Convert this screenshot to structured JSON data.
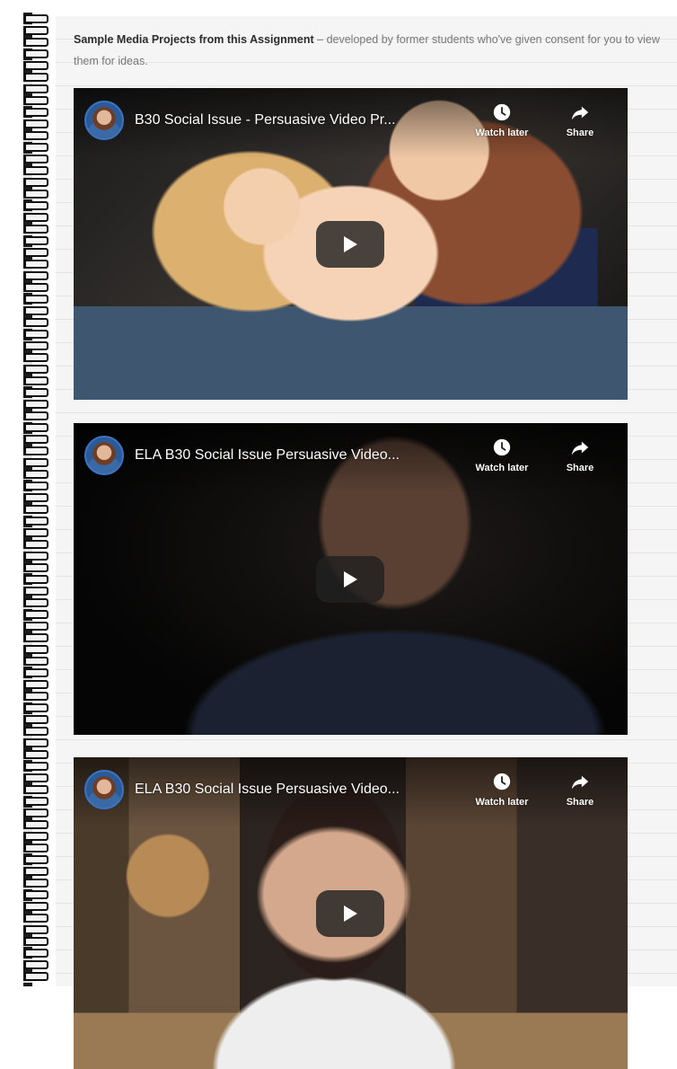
{
  "intro": {
    "bold": "Sample Media Projects from this Assignment",
    "rest": " – developed by former students who've given consent for you to view them for ideas."
  },
  "videos": [
    {
      "title": "B30 Social Issue - Persuasive Video Pr...",
      "watch_later": "Watch later",
      "share": "Share"
    },
    {
      "title": "ELA B30 Social Issue Persuasive Video...",
      "watch_later": "Watch later",
      "share": "Share"
    },
    {
      "title": "ELA B30 Social Issue Persuasive Video...",
      "watch_later": "Watch later",
      "share": "Share"
    }
  ],
  "icons": {
    "binding": "spiral-binding",
    "avatar": "channel-avatar",
    "watch_later": "clock-icon",
    "share": "share-arrow-icon",
    "play": "play-icon"
  },
  "colors": {
    "paper": "#f5f5f5",
    "rule_line": "#e4e4e4",
    "intro_text": "#777777",
    "intro_bold": "#2d2d2d",
    "play_button": "#212121"
  }
}
